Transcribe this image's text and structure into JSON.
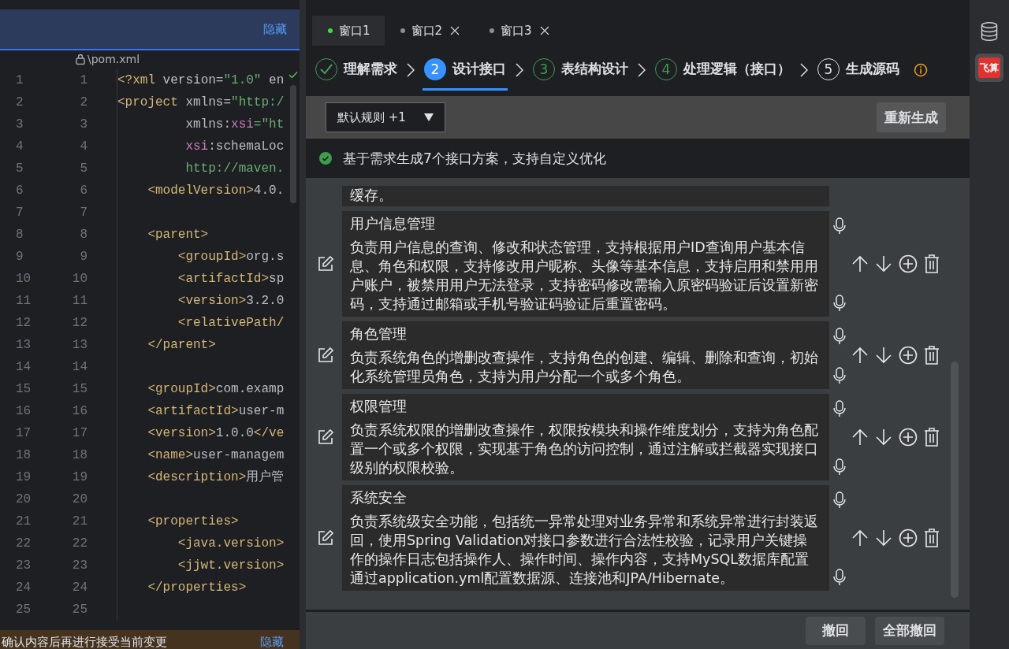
{
  "editor": {
    "banner": {
      "action": "隐藏"
    },
    "file_path": "\\pom.xml",
    "lines": [
      {
        "numbers": [
          "1",
          "1"
        ],
        "tokens": [
          {
            "kind": "tag",
            "text": "<?xml"
          },
          {
            "kind": "text",
            "text": " version="
          },
          {
            "kind": "value",
            "text": "\"1.0\""
          },
          {
            "kind": "text",
            "text": " en"
          }
        ]
      },
      {
        "numbers": [
          "2",
          "2"
        ],
        "tokens": [
          {
            "kind": "tag",
            "text": "<project"
          },
          {
            "kind": "text",
            "text": " xmlns="
          },
          {
            "kind": "value",
            "text": "\"http:/"
          }
        ]
      },
      {
        "numbers": [
          "3",
          "3"
        ],
        "tokens": [
          {
            "kind": "text",
            "text": "         xmlns:"
          },
          {
            "kind": "ns",
            "text": "xsi"
          },
          {
            "kind": "value",
            "text": "=\"ht"
          }
        ]
      },
      {
        "numbers": [
          "4",
          "4"
        ],
        "tokens": [
          {
            "kind": "ns",
            "text": "         xsi"
          },
          {
            "kind": "text",
            "text": ":schemaLoc"
          }
        ]
      },
      {
        "numbers": [
          "5",
          "5"
        ],
        "tokens": [
          {
            "kind": "value",
            "text": "         http://maven."
          }
        ]
      },
      {
        "numbers": [
          "6",
          "6"
        ],
        "tokens": [
          {
            "kind": "tag",
            "text": "    <modelVersion>"
          },
          {
            "kind": "text",
            "text": "4.0."
          }
        ]
      },
      {
        "numbers": [
          "7",
          "7"
        ]
      },
      {
        "numbers": [
          "8",
          "8"
        ],
        "tokens": [
          {
            "kind": "tag",
            "text": "    <parent>"
          }
        ]
      },
      {
        "numbers": [
          "9",
          "9"
        ],
        "tokens": [
          {
            "kind": "tag",
            "text": "        <groupId>"
          },
          {
            "kind": "text",
            "text": "org.s"
          }
        ]
      },
      {
        "numbers": [
          "10",
          "10"
        ],
        "tokens": [
          {
            "kind": "tag",
            "text": "        <artifactId>"
          },
          {
            "kind": "text",
            "text": "sp"
          }
        ]
      },
      {
        "numbers": [
          "11",
          "11"
        ],
        "tokens": [
          {
            "kind": "tag",
            "text": "        <version>"
          },
          {
            "kind": "text",
            "text": "3.2.0"
          }
        ]
      },
      {
        "numbers": [
          "12",
          "12"
        ],
        "tokens": [
          {
            "kind": "tag",
            "text": "        <relativePath/"
          }
        ]
      },
      {
        "numbers": [
          "13",
          "13"
        ],
        "tokens": [
          {
            "kind": "tag",
            "text": "    </parent>"
          }
        ]
      },
      {
        "numbers": [
          "14",
          "14"
        ]
      },
      {
        "numbers": [
          "15",
          "15"
        ],
        "tokens": [
          {
            "kind": "tag",
            "text": "    <groupId>"
          },
          {
            "kind": "text",
            "text": "com.examp"
          }
        ]
      },
      {
        "numbers": [
          "16",
          "16"
        ],
        "tokens": [
          {
            "kind": "tag",
            "text": "    <artifactId>"
          },
          {
            "kind": "text",
            "text": "user-m"
          }
        ]
      },
      {
        "numbers": [
          "17",
          "17"
        ],
        "tokens": [
          {
            "kind": "tag",
            "text": "    <version>"
          },
          {
            "kind": "text",
            "text": "1.0.0"
          },
          {
            "kind": "tag",
            "text": "</ve"
          }
        ]
      },
      {
        "numbers": [
          "18",
          "18"
        ],
        "tokens": [
          {
            "kind": "tag",
            "text": "    <name>"
          },
          {
            "kind": "text",
            "text": "user-managem"
          }
        ]
      },
      {
        "numbers": [
          "19",
          "19"
        ],
        "tokens": [
          {
            "kind": "tag",
            "text": "    <description>"
          },
          {
            "kind": "text",
            "text": "用户管"
          }
        ]
      },
      {
        "numbers": [
          "20",
          "20"
        ]
      },
      {
        "numbers": [
          "21",
          "21"
        ],
        "tokens": [
          {
            "kind": "tag",
            "text": "    <properties>"
          }
        ]
      },
      {
        "numbers": [
          "22",
          "22"
        ],
        "tokens": [
          {
            "kind": "tag",
            "text": "        <java.version>"
          }
        ]
      },
      {
        "numbers": [
          "23",
          "23"
        ],
        "tokens": [
          {
            "kind": "tag",
            "text": "        <jjwt.version>"
          }
        ]
      },
      {
        "numbers": [
          "24",
          "24"
        ],
        "tokens": [
          {
            "kind": "tag",
            "text": "    </properties>"
          }
        ]
      },
      {
        "numbers": [
          "25",
          "25"
        ]
      }
    ],
    "notice": {
      "text": "确认内容后再进行接受当前变更",
      "action": "隐藏"
    }
  },
  "tabs": [
    {
      "label": "窗口1",
      "selected": true,
      "closable": false
    },
    {
      "label": "窗口2",
      "selected": false,
      "closable": true
    },
    {
      "label": "窗口3",
      "selected": false,
      "closable": true
    }
  ],
  "steps": [
    {
      "label": "理解需求",
      "kind": "done",
      "selected": false
    },
    {
      "label": "设计接口",
      "number": "2",
      "kind": "active",
      "selected": true
    },
    {
      "label": "表结构设计",
      "number": "3",
      "kind": "ready",
      "selected": false
    },
    {
      "label": "处理逻辑（接口）",
      "number": "4",
      "kind": "ready",
      "selected": false
    },
    {
      "label": "生成源码",
      "number": "5",
      "kind": "pending",
      "selected": false
    }
  ],
  "toolbar": {
    "rule_dropdown": "默认规则 +1",
    "regenerate": "重新生成"
  },
  "status": "基于需求生成7个接口方案，支持自定义优化",
  "interfaces": [
    {
      "kind": "partial",
      "description": "缓存。"
    },
    {
      "kind": "full",
      "title": "用户信息管理",
      "description": "负责用户信息的查询、修改和状态管理，支持根据用户ID查询用户基本信息、角色和权限，支持修改用户昵称、头像等基本信息，支持启用和禁用用户账户，被禁用用户无法登录，支持密码修改需输入原密码验证后设置新密码，支持通过邮箱或手机号验证码验证后重置密码。"
    },
    {
      "kind": "full",
      "title": "角色管理",
      "description": "负责系统角色的增删改查操作，支持角色的创建、编辑、删除和查询，初始化系统管理员角色，支持为用户分配一个或多个角色。"
    },
    {
      "kind": "full",
      "title": "权限管理",
      "description": "负责系统权限的增删改查操作，权限按模块和操作维度划分，支持为角色配置一个或多个权限，实现基于角色的访问控制，通过注解或拦截器实现接口级别的权限校验。"
    },
    {
      "kind": "full",
      "title": "系统安全",
      "description": "负责系统级安全功能，包括统一异常处理对业务异常和系统异常进行封装返回，使用Spring Validation对接口参数进行合法性校验，记录用户关键操作的操作日志包括操作人、操作时间、操作内容，支持MySQL数据库配置通过application.yml配置数据源、连接池和JPA/Hibernate。"
    }
  ],
  "footer": {
    "buttons": [
      "撤回",
      "全部撤回"
    ]
  },
  "rail": {
    "logo": "飞算"
  }
}
